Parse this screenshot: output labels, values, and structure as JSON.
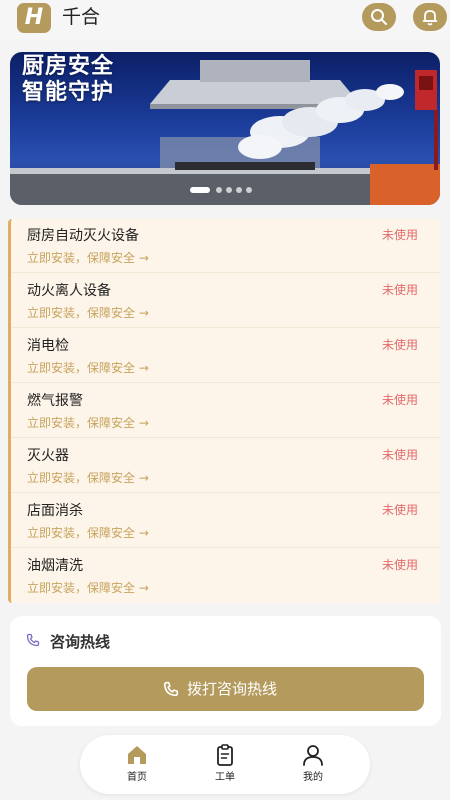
{
  "header": {
    "logo_letter": "H",
    "title": "千合",
    "search_icon": "search-icon",
    "bell_icon": "bell-icon"
  },
  "banner": {
    "line1": "厨房安全",
    "line2": "智能守护",
    "slide_count": 5,
    "active_slide": 1
  },
  "services": [
    {
      "name": "厨房自动灭火设备",
      "sub": "立即安装，保障安全 →",
      "status": "未使用"
    },
    {
      "name": "动火离人设备",
      "sub": "立即安装，保障安全 →",
      "status": "未使用"
    },
    {
      "name": "消电检",
      "sub": "立即安装，保障安全 →",
      "status": "未使用"
    },
    {
      "name": "燃气报警",
      "sub": "立即安装，保障安全 →",
      "status": "未使用"
    },
    {
      "name": "灭火器",
      "sub": "立即安装，保障安全 →",
      "status": "未使用"
    },
    {
      "name": "店面消杀",
      "sub": "立即安装，保障安全 →",
      "status": "未使用"
    },
    {
      "name": "油烟清洗",
      "sub": "立即安装，保障安全 →",
      "status": "未使用"
    }
  ],
  "hotline": {
    "title": "咨询热线",
    "button_label": "拨打咨询热线",
    "icon": "phone-icon"
  },
  "nav": {
    "items": [
      {
        "label": "首页",
        "icon": "home-icon",
        "active": true
      },
      {
        "label": "工单",
        "icon": "clipboard-icon",
        "active": false
      },
      {
        "label": "我的",
        "icon": "user-icon",
        "active": false
      }
    ]
  },
  "colors": {
    "accent": "#b59a5d",
    "status_red": "#e36a6a",
    "list_bg": "#fdf5ea",
    "list_border": "#e3ac62"
  }
}
